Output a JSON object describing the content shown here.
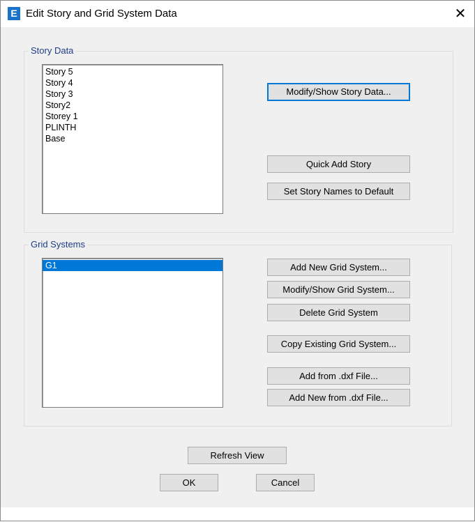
{
  "window": {
    "title": "Edit Story and Grid System Data",
    "icon_letter": "E",
    "icon_name": "app-icon",
    "close_icon": "close-icon",
    "close_glyph": "✕"
  },
  "story_data": {
    "legend": "Story Data",
    "stories": [
      "Story 5",
      "Story 4",
      "Story 3",
      "Story2",
      "Storey 1",
      "PLINTH",
      "Base"
    ],
    "modify_button": "Modify/Show Story Data...",
    "quick_add_button": "Quick Add Story",
    "default_names_button": "Set Story Names to Default"
  },
  "grid_systems": {
    "legend": "Grid Systems",
    "items": [
      "G1"
    ],
    "selected": "G1",
    "add_new_button": "Add New Grid System...",
    "modify_button": "Modify/Show Grid System...",
    "delete_button": "Delete Grid System",
    "copy_button": "Copy Existing Grid System...",
    "add_dxf_button": "Add  from .dxf File...",
    "add_new_dxf_button": "Add New from .dxf File..."
  },
  "footer": {
    "refresh_button": "Refresh View",
    "ok_button": "OK",
    "cancel_button": "Cancel"
  },
  "colors": {
    "accent": "#0078d7",
    "legend_text": "#1f3c88",
    "dialog_bg": "#f0f0f0"
  }
}
